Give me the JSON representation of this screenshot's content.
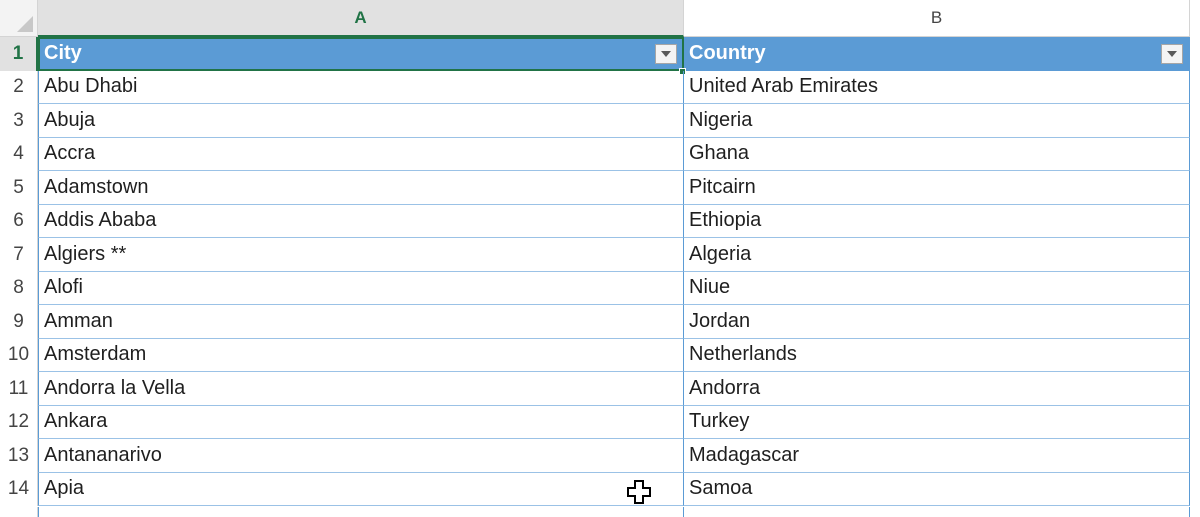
{
  "columns": [
    {
      "letter": "A",
      "selected": true
    },
    {
      "letter": "B",
      "selected": false
    }
  ],
  "header_row": {
    "row_number": "1",
    "city_label": "City",
    "country_label": "Country"
  },
  "rows": [
    {
      "num": "2",
      "city": "Abu Dhabi",
      "country": "United Arab Emirates"
    },
    {
      "num": "3",
      "city": "Abuja",
      "country": "Nigeria"
    },
    {
      "num": "4",
      "city": "Accra",
      "country": "Ghana"
    },
    {
      "num": "5",
      "city": "Adamstown",
      "country": "Pitcairn"
    },
    {
      "num": "6",
      "city": "Addis Ababa",
      "country": "Ethiopia"
    },
    {
      "num": "7",
      "city": "Algiers **",
      "country": "Algeria"
    },
    {
      "num": "8",
      "city": "Alofi",
      "country": "Niue"
    },
    {
      "num": "9",
      "city": "Amman",
      "country": "Jordan"
    },
    {
      "num": "10",
      "city": "Amsterdam",
      "country": "Netherlands"
    },
    {
      "num": "11",
      "city": "Andorra la Vella",
      "country": "Andorra"
    },
    {
      "num": "12",
      "city": "Ankara",
      "country": "Turkey"
    },
    {
      "num": "13",
      "city": "Antananarivo",
      "country": "Madagascar"
    },
    {
      "num": "14",
      "city": "Apia",
      "country": "Samoa"
    }
  ],
  "icons": {
    "dropdown": "chevron-down-icon",
    "cursor": "cell-select-cursor-icon"
  },
  "colors": {
    "header_fill": "#5b9bd5",
    "selection": "#217346",
    "gridline": "#9bc2e6"
  }
}
